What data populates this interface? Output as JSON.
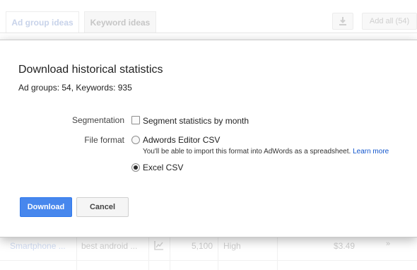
{
  "tabs": {
    "ad_group_ideas": "Ad group ideas",
    "keyword_ideas": "Keyword ideas"
  },
  "toolbar": {
    "download_icon": "download-icon",
    "add_all": "Add all (54)"
  },
  "dialog": {
    "title": "Download historical statistics",
    "summary": "Ad groups: 54, Keywords: 935",
    "segmentation_label": "Segmentation",
    "segmentation_option": "Segment statistics by month",
    "segmentation_checked": false,
    "file_format_label": "File format",
    "formats": [
      {
        "label": "Adwords Editor CSV",
        "hint": "You'll be able to import this format into AdWords as a spreadsheet.",
        "selected": false
      },
      {
        "label": "Excel CSV",
        "selected": true
      }
    ],
    "learn_more": "Learn more",
    "download_button": "Download",
    "cancel_button": "Cancel"
  },
  "background_row": {
    "ad_group": "Smartphone ...",
    "keywords": "best android ...",
    "trend_icon": "trend-chart-icon",
    "searches": "5,100",
    "competition": "High",
    "bid": "$3.49",
    "add_icon": "chevron-double-icon"
  },
  "colors": {
    "primary_button": "#4787ed",
    "link": "#1155cc"
  }
}
